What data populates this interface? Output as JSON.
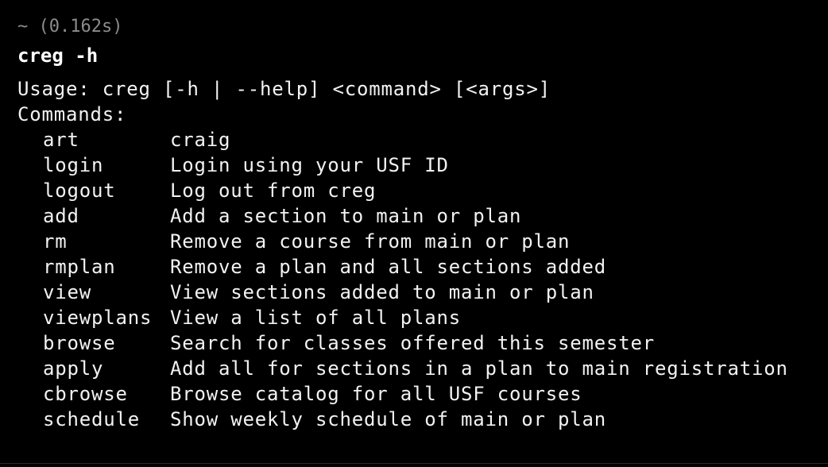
{
  "prompt": {
    "text": "~ (0.162s)"
  },
  "command": {
    "text": "creg -h"
  },
  "output": {
    "usage": "Usage: creg [-h | --help] <command> [<args>]",
    "commands_header": "Commands:",
    "commands": [
      {
        "name": "art",
        "desc": "craig"
      },
      {
        "name": "login",
        "desc": "Login using your USF ID"
      },
      {
        "name": "logout",
        "desc": "Log out from creg"
      },
      {
        "name": "add",
        "desc": "Add a section to main or plan"
      },
      {
        "name": "rm",
        "desc": "Remove a course from main or plan"
      },
      {
        "name": "rmplan",
        "desc": "Remove a plan and all sections added"
      },
      {
        "name": "view",
        "desc": "View sections added to main or plan"
      },
      {
        "name": "viewplans",
        "desc": "View a list of all plans"
      },
      {
        "name": "browse",
        "desc": "Search for classes offered this semester"
      },
      {
        "name": "apply",
        "desc": "Add all for sections in a plan to main registration"
      },
      {
        "name": "cbrowse",
        "desc": "Browse catalog for all USF courses"
      },
      {
        "name": "schedule",
        "desc": "Show weekly schedule of main or plan"
      }
    ]
  },
  "colors": {
    "background": "#000000",
    "text": "#f2f2f2",
    "prompt": "#8c8c8c"
  }
}
